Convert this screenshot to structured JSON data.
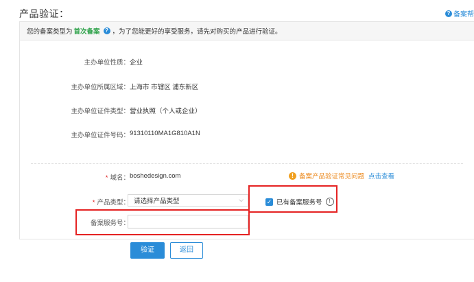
{
  "header": {
    "title": "产品验证：",
    "help_label": "备案帮"
  },
  "notice": {
    "prefix": "您的备案类型为",
    "record_type": "首次备案",
    "suffix": "，为了您能更好的享受服务，请先对购买的产品进行验证。"
  },
  "info": {
    "rows": [
      {
        "label": "主办单位性质：",
        "value": "企业"
      },
      {
        "label": "主办单位所属区域：",
        "value": "上海市 市辖区 浦东新区"
      },
      {
        "label": "主办单位证件类型：",
        "value": "营业执照（个人或企业）"
      },
      {
        "label": "主办单位证件号码：",
        "value": "91310110MA1G810A1N"
      }
    ]
  },
  "form": {
    "domain_label": "域名：",
    "domain_value": "boshedesign.com",
    "tip_text": "备案产品验证常见问题",
    "tip_link": "点击查看",
    "product_type_label": "产品类型：",
    "product_type_value": "请选择产品类型",
    "has_service_no_label": "已有备案服务号",
    "has_service_no_checked": true,
    "service_no_label": "备案服务号：",
    "service_no_value": ""
  },
  "buttons": {
    "verify": "验证",
    "back": "返回"
  },
  "colors": {
    "accent": "#2a8cd8",
    "highlight": "#e52222",
    "record_type": "#2ea24a",
    "tip": "#ec8a1f"
  }
}
